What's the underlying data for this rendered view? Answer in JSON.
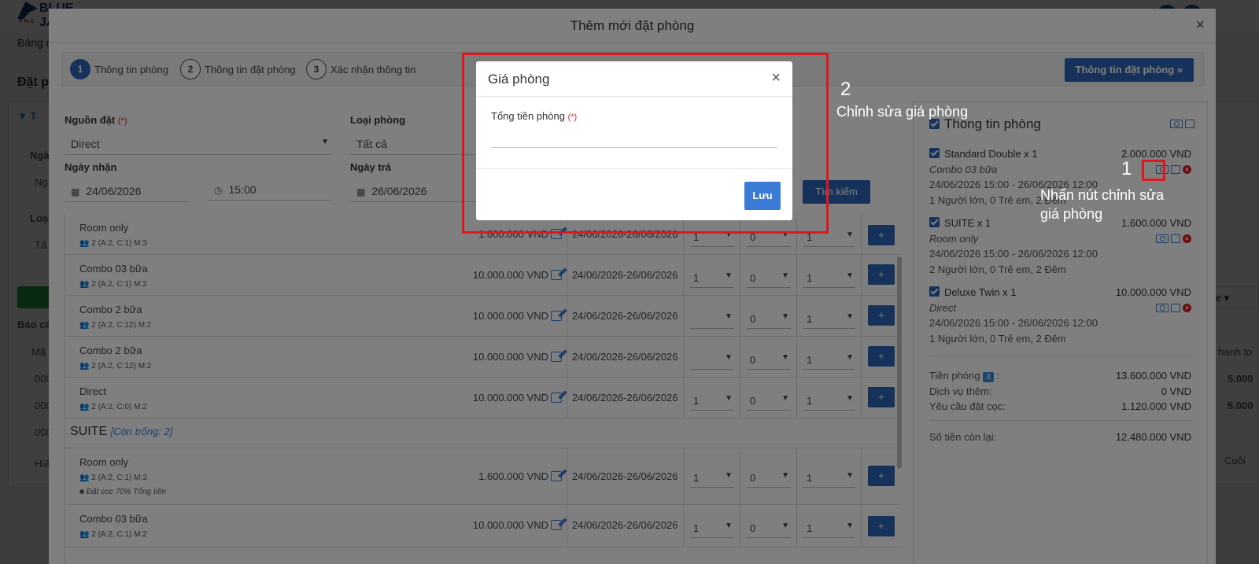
{
  "background": {
    "logo_text": "BLUE JAY",
    "logo_sub": "PMS",
    "nav_label": "Bảng đ",
    "page_title": "Đặt p",
    "filter_label": "T",
    "left_labels": [
      "Ngà",
      "Ng",
      "Loại",
      "Tấ",
      "Báo cá",
      "Mã",
      "000",
      "000",
      "000",
      "Hiể"
    ],
    "right_labels": [
      "hanh to",
      "5.000",
      "5.000",
      "Cuối"
    ],
    "file_button": "ile"
  },
  "modal": {
    "title": "Thêm mới đặt phòng",
    "close": "×",
    "steps": [
      {
        "num": "1",
        "label": "Thông tin phòng"
      },
      {
        "num": "2",
        "label": "Thông tin đặt phòng"
      },
      {
        "num": "3",
        "label": "Xác nhận thông tin"
      }
    ],
    "next_button": "Thông tin đặt phòng »",
    "form": {
      "source_label": "Nguồn đặt",
      "source_value": "Direct",
      "room_type_label": "Loại phòng",
      "room_type_value": "Tất cả",
      "checkin_label": "Ngày nhận",
      "checkin_date": "24/06/2026",
      "checkin_time": "15:00",
      "checkout_label": "Ngày trả",
      "checkout_date": "26/06/2026",
      "required_mark": "(*)",
      "search_button": "Tìm kiếm"
    },
    "group_suite": {
      "name": "SUITE",
      "available": "[Còn trống: 2]"
    },
    "rows": [
      {
        "name": "Room only",
        "cap": "2 (A:2, C:1) M:3",
        "price": "1.600.000 VND",
        "date": "24/06/2026-26/06/2026",
        "s1": "1",
        "s2": "0",
        "s3": "1"
      },
      {
        "name": "Combo 03 bữa",
        "cap": "2 (A:2, C:1) M:2",
        "price": "10.000.000 VND",
        "date": "24/06/2026-26/06/2026",
        "s1": "1",
        "s2": "0",
        "s3": "1"
      },
      {
        "name": "Combo 2 bữa",
        "cap": "2 (A:2, C:12) M:2",
        "price": "10.000.000 VND",
        "date": "24/06/2026-26/06/2026",
        "s1": "",
        "s2": "0",
        "s3": "1"
      },
      {
        "name": "Combo 2 bữa",
        "cap": "2 (A:2, C:12) M:2",
        "price": "10.000.000 VND",
        "date": "24/06/2026-26/06/2026",
        "s1": "",
        "s2": "0",
        "s3": "1"
      },
      {
        "name": "Direct",
        "cap": "2 (A:2, C:0) M:2",
        "price": "10.000.000 VND",
        "date": "24/06/2026-26/06/2026",
        "s1": "1",
        "s2": "0",
        "s3": "1"
      },
      {
        "name": "Room only",
        "cap": "2 (A:2, C:1) M:3",
        "note": "Đặt cọc 70% Tổng tiền",
        "price": "1.600.000 VND",
        "date": "24/06/2026-26/06/2026",
        "s1": "1",
        "s2": "0",
        "s3": "1"
      },
      {
        "name": "Combo 03 bữa",
        "cap": "2 (A:2, C:1) M:2",
        "price": "10.000.000 VND",
        "date": "24/06/2026-26/06/2026",
        "s1": "1",
        "s2": "0",
        "s3": "1"
      }
    ],
    "plus": "+",
    "summary": {
      "title": "Thông tin phòng",
      "items": [
        {
          "name": "Standard Double x 1",
          "price": "2.000.000 VND",
          "package": "Combo 03 bữa",
          "dates": "24/06/2026 15:00 - 26/06/2026 12:00",
          "guests": "1 Người lớn, 0 Trẻ em, 2 Đêm"
        },
        {
          "name": "SUITE x 1",
          "price": "1.600.000 VND",
          "package": "Room only",
          "dates": "24/06/2026 15:00 - 26/06/2026 12:00",
          "guests": "2 Người lớn, 0 Trẻ em, 2 Đêm"
        },
        {
          "name": "Deluxe Twin x 1",
          "price": "10.000.000 VND",
          "package": "Direct",
          "dates": "24/06/2026 15:00 - 26/06/2026 12:00",
          "guests": "1 Người lớn, 0 Trẻ em, 2 Đêm"
        }
      ],
      "room_total_label": "Tiền phòng",
      "room_count": "3",
      "room_total_colon": ":",
      "room_total": "13.600.000 VND",
      "extra_label": "Dịch vụ thêm:",
      "extra_value": "0 VND",
      "deposit_label": "Yêu cầu đặt cọc:",
      "deposit_value": "1.120.000 VND",
      "remaining_label": "Số tiền còn lại:",
      "remaining_value": "12.480.000 VND"
    }
  },
  "dialog": {
    "title": "Giá phòng",
    "close": "×",
    "field_label": "Tổng tiền phòng",
    "required_mark": "(*)",
    "field_value": "",
    "save_button": "Lưu"
  },
  "annotations": {
    "step1_num": "1",
    "step1_text_l1": "Nhấn nút chỉnh sửa",
    "step1_text_l2": "giá  phòng",
    "step2_num": "2",
    "step2_text": "Chỉnh sửa giá phòng"
  },
  "colors": {
    "primary": "#2d64b6",
    "annotation_red": "#e0171f",
    "danger": "#d81e1e"
  }
}
